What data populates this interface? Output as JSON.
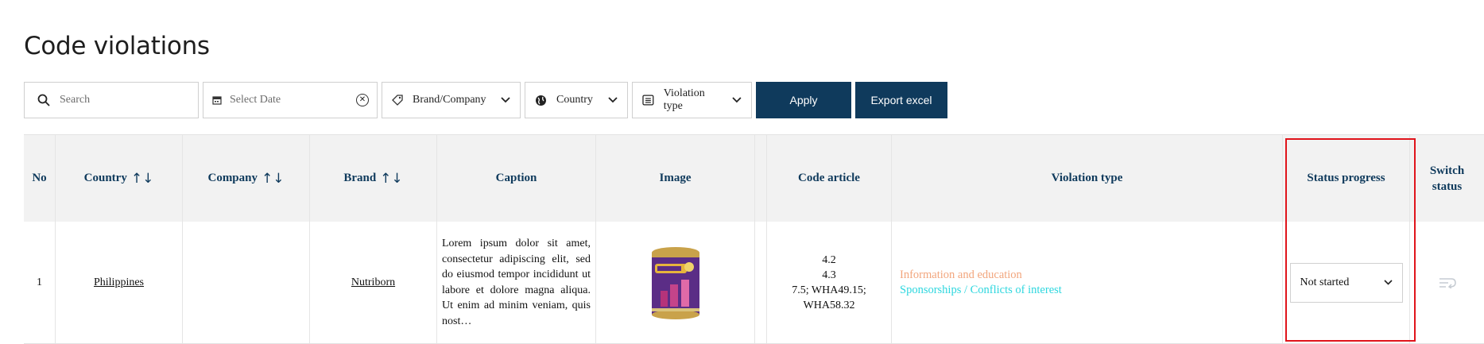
{
  "page": {
    "title": "Code violations"
  },
  "filters": {
    "search_placeholder": "Search",
    "date_placeholder": "Select Date",
    "brand_label": "Brand/Company",
    "country_label": "Country",
    "violation_label": "Violation type",
    "apply_label": "Apply",
    "export_label": "Export excel"
  },
  "table": {
    "headers": {
      "no": "No",
      "country": "Country",
      "company": "Company",
      "brand": "Brand",
      "caption": "Caption",
      "image": "Image",
      "code_article": "Code article",
      "violation_type": "Violation type",
      "status_progress": "Status progress",
      "switch_status_1": "Switch",
      "switch_status_2": "status"
    },
    "sort_symbol": "↑↓",
    "rows": [
      {
        "no": "1",
        "country": "Philippines",
        "company": "",
        "brand": "Nutriborn",
        "caption": "Lorem ipsum dolor sit amet, consectetur adipiscing elit, sed do eiusmod tempor incididunt ut labore et dolore magna aliqua. Ut enim ad minim veniam, quis nost…",
        "code_articles": [
          "4.2",
          "4.3",
          "7.5; WHA49.15;",
          "WHA58.32"
        ],
        "violation_types": [
          {
            "label": "Information and education",
            "color": "#f2a57c"
          },
          {
            "label": "Sponsorships / Conflicts of interest",
            "color": "#2ed7df"
          }
        ],
        "status": "Not started"
      }
    ]
  },
  "icons": {
    "search": "search-icon",
    "calendar": "calendar-icon",
    "clear": "clear-icon",
    "tag": "tag-icon",
    "globe": "globe-icon",
    "list": "list-icon",
    "chevron": "chevron-down-icon",
    "switch": "switch-status-icon"
  },
  "colors": {
    "accent": "#0f3a5c",
    "highlight": "#e0141b"
  }
}
